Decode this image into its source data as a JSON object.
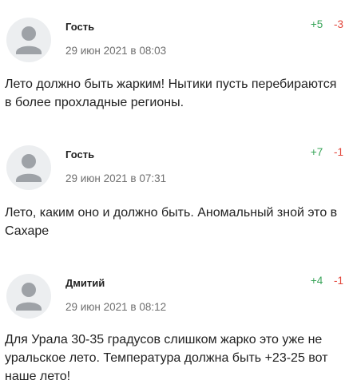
{
  "comments": [
    {
      "author": "Гость",
      "date": "29 июн 2021 в 08:03",
      "likes": "+5",
      "dislikes": "-3",
      "text": "Лето должно быть жарким! Нытики пусть перебираются в более прохладные регионы.",
      "avatar_icon": "user-silhouette-icon"
    },
    {
      "author": "Гость",
      "date": "29 июн 2021 в 07:31",
      "likes": "+7",
      "dislikes": "-1",
      "text": "Лето, каким оно и должно быть. Аномальный зной это в Сахаре",
      "avatar_icon": "user-silhouette-icon"
    },
    {
      "author": "Дмитий",
      "date": "29 июн 2021 в 08:12",
      "likes": "+4",
      "dislikes": "-1",
      "text": "Для Урала 30-35 градусов слишком жарко это уже не уральское лето. Температура должна быть +23-25 вот наше лето!",
      "avatar_icon": "user-silhouette-icon"
    }
  ],
  "colors": {
    "likes": "#3aa55a",
    "dislikes": "#e2453a",
    "date": "#6f6f6f",
    "text": "#222222",
    "avatar_bg": "#eceef0",
    "avatar_figure": "#9ea2a7"
  }
}
